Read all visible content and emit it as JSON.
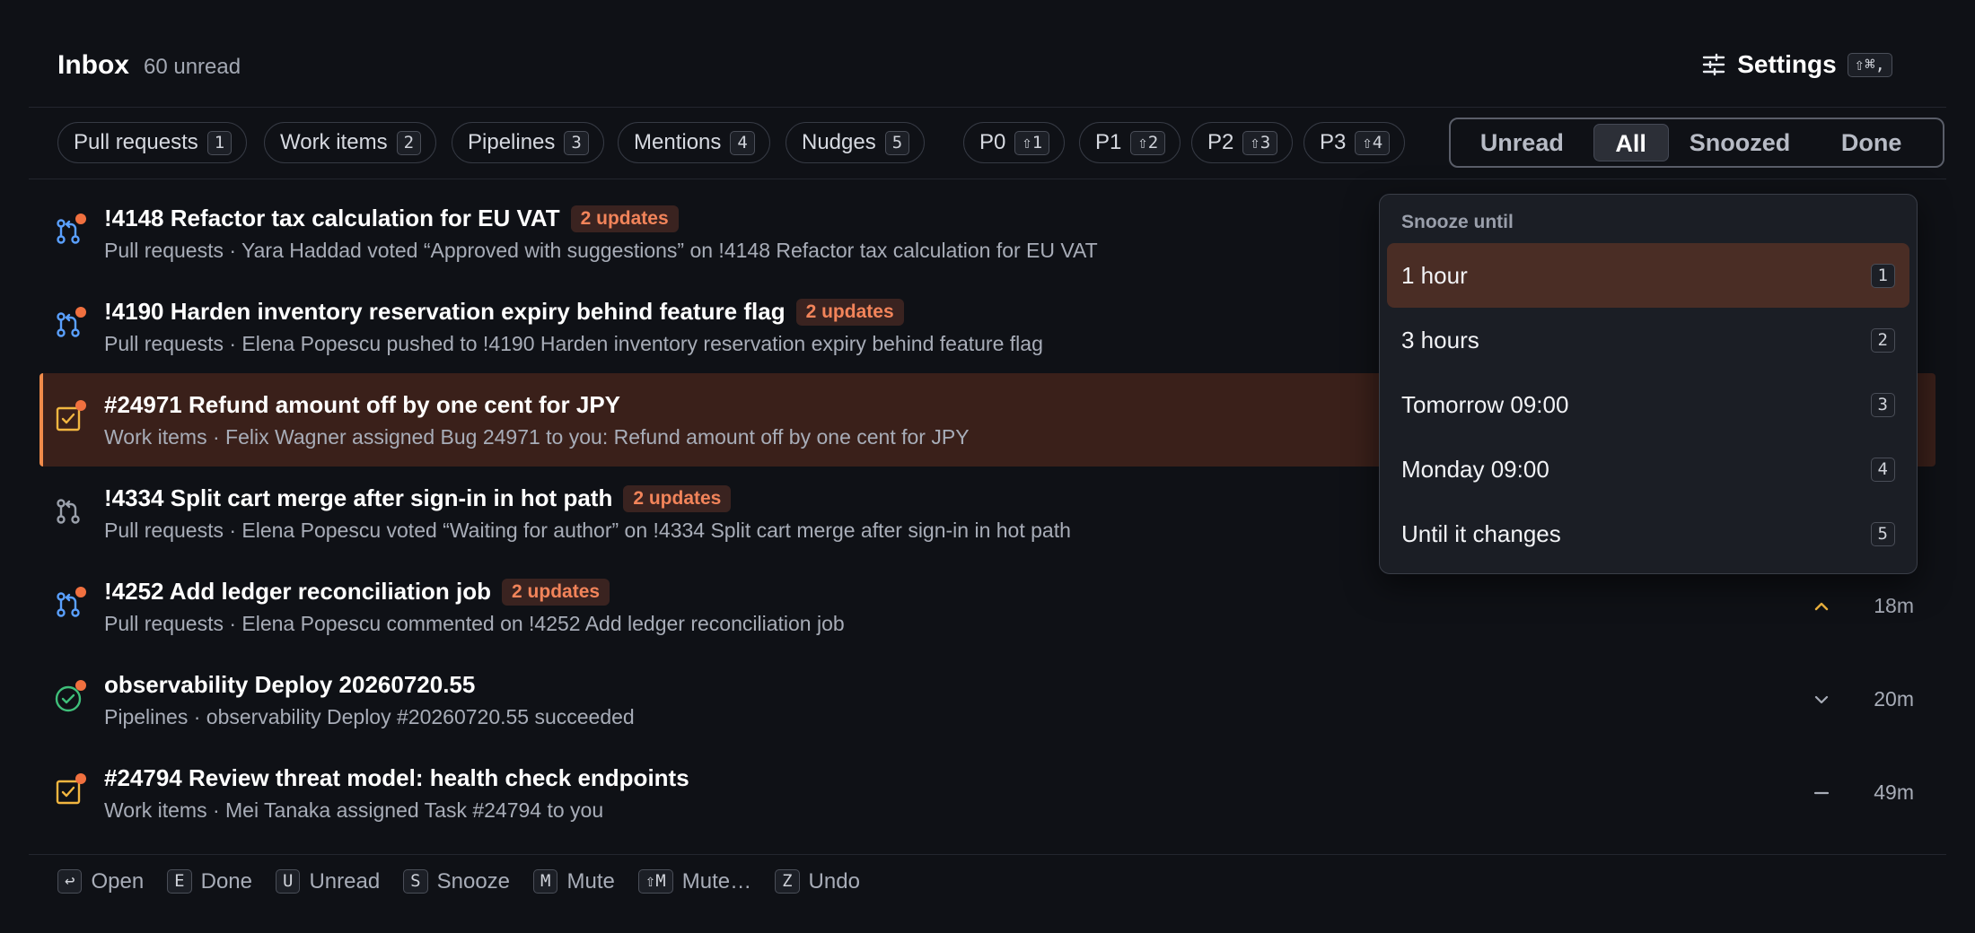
{
  "header": {
    "title": "Inbox",
    "unread": "60 unread",
    "settings_label": "Settings",
    "settings_shortcut": "⇧⌘,"
  },
  "filters": [
    {
      "label": "Pull requests",
      "key": "1"
    },
    {
      "label": "Work items",
      "key": "2"
    },
    {
      "label": "Pipelines",
      "key": "3"
    },
    {
      "label": "Mentions",
      "key": "4"
    },
    {
      "label": "Nudges",
      "key": "5"
    }
  ],
  "priorities": [
    {
      "label": "P0",
      "key": "⇧1"
    },
    {
      "label": "P1",
      "key": "⇧2"
    },
    {
      "label": "P2",
      "key": "⇧3"
    },
    {
      "label": "P3",
      "key": "⇧4"
    }
  ],
  "views": [
    "Unread",
    "All",
    "Snoozed",
    "Done"
  ],
  "active_view": "All",
  "items": [
    {
      "icon": "pull-request-icon",
      "title": "!4148 Refactor tax calculation for EU VAT",
      "badge": "2 updates",
      "subtitle": "Pull requests · Yara Haddad voted “Approved with suggestions” on !4148 Refactor tax calculation for EU VAT",
      "priority": "",
      "time": "",
      "unread": true,
      "selected": false
    },
    {
      "icon": "pull-request-icon",
      "title": "!4190 Harden inventory reservation expiry behind feature flag",
      "badge": "2 updates",
      "subtitle": "Pull requests · Elena Popescu pushed to !4190 Harden inventory reservation expiry behind feature flag",
      "priority": "",
      "time": "",
      "unread": true,
      "selected": false
    },
    {
      "icon": "work-item-icon",
      "title": "#24971 Refund amount off by one cent for JPY",
      "badge": "",
      "subtitle": "Work items · Felix Wagner assigned Bug 24971 to you: Refund amount off by one cent for JPY",
      "priority": "",
      "time": "",
      "unread": true,
      "selected": true
    },
    {
      "icon": "pull-request-icon",
      "title": "!4334 Split cart merge after sign-in in hot path",
      "badge": "2 updates",
      "subtitle": "Pull requests · Elena Popescu voted “Waiting for author” on !4334 Split cart merge after sign-in in hot path",
      "priority": "",
      "time": "",
      "unread": false,
      "selected": false
    },
    {
      "icon": "pull-request-icon",
      "title": "!4252 Add ledger reconciliation job",
      "badge": "2 updates",
      "subtitle": "Pull requests · Elena Popescu commented on !4252 Add ledger reconciliation job",
      "priority": "high",
      "time": "18m",
      "unread": true,
      "selected": false
    },
    {
      "icon": "pipeline-success-icon",
      "title": "observability Deploy 20260720.55",
      "badge": "",
      "subtitle": "Pipelines · observability Deploy #20260720.55 succeeded",
      "priority": "low",
      "time": "20m",
      "unread": true,
      "selected": false
    },
    {
      "icon": "work-item-icon",
      "title": "#24794 Review threat model: health check endpoints",
      "badge": "",
      "subtitle": "Work items · Mei Tanaka assigned Task #24794 to you",
      "priority": "medium",
      "time": "49m",
      "unread": true,
      "selected": false
    }
  ],
  "footer": [
    {
      "key": "↩",
      "label": "Open"
    },
    {
      "key": "E",
      "label": "Done"
    },
    {
      "key": "U",
      "label": "Unread"
    },
    {
      "key": "S",
      "label": "Snooze"
    },
    {
      "key": "M",
      "label": "Mute"
    },
    {
      "key": "⇧M",
      "label": "Mute…"
    },
    {
      "key": "Z",
      "label": "Undo"
    }
  ],
  "snooze": {
    "title": "Snooze until",
    "options": [
      {
        "label": "1 hour",
        "key": "1"
      },
      {
        "label": "3 hours",
        "key": "2"
      },
      {
        "label": "Tomorrow 09:00",
        "key": "3"
      },
      {
        "label": "Monday 09:00",
        "key": "4"
      },
      {
        "label": "Until it changes",
        "key": "5"
      }
    ],
    "highlighted": "1 hour"
  },
  "colors": {
    "accent": "#f0703f",
    "pull_request": "#5aa0ff",
    "work_item": "#f2b640",
    "pipeline_success": "#3fbf7a",
    "priority_high": "#f2b640"
  }
}
